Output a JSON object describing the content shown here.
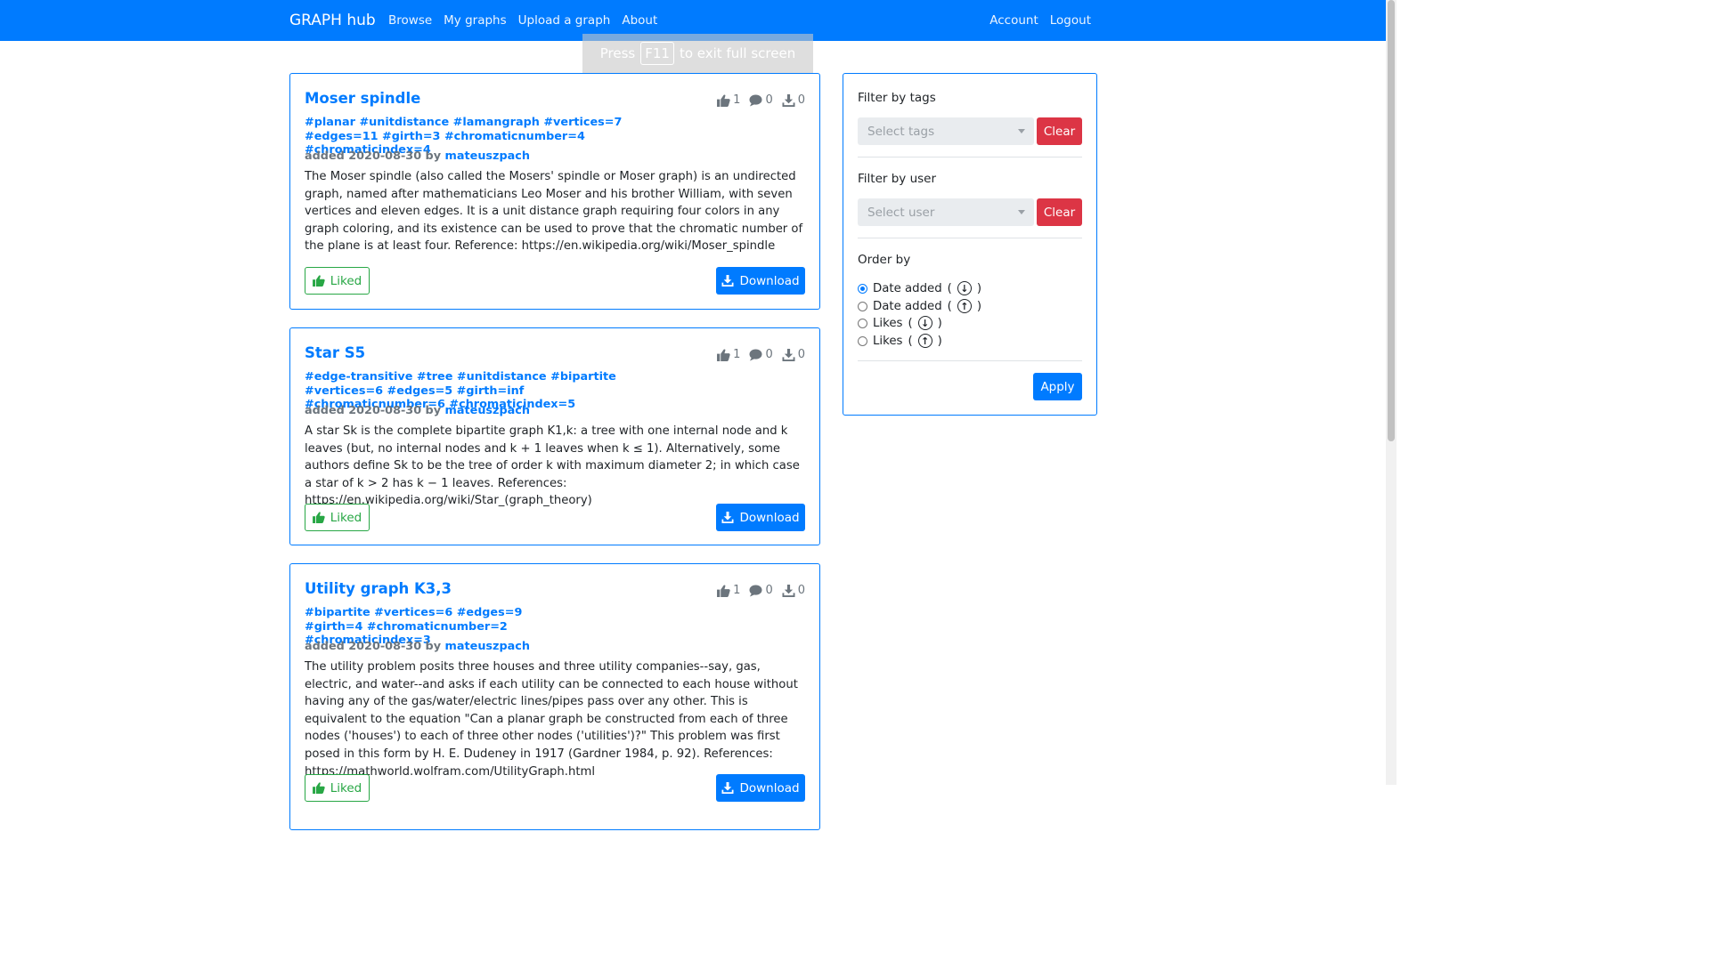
{
  "navbar": {
    "brand": "GRAPH hub",
    "links_left": [
      "Browse",
      "My graphs",
      "Upload a graph"
    ],
    "about": "About",
    "account": "Account",
    "logout": "Logout"
  },
  "fullscreen_banner": {
    "prefix": "Press",
    "key": "F11",
    "suffix": "to exit full screen"
  },
  "graphs": [
    {
      "title": "Moser spindle",
      "likes": "1",
      "comments": "0",
      "downloads": "0",
      "tags": [
        "#planar",
        "#unitdistance",
        "#lamangraph",
        "#vertices=7",
        "#edges=11",
        "#girth=3",
        "#chromaticnumber=4",
        "#chromaticindex=4"
      ],
      "added": "added 2020-08-30 by",
      "user": "mateuszpach",
      "description": "The Moser spindle (also called the Mosers' spindle or Moser graph) is an undirected graph, named after mathematicians Leo Moser and his brother William, with seven vertices and eleven edges. It is a unit distance graph requiring four colors in any graph coloring, and its existence can be used to prove that the chromatic number of the plane is at least four. Reference: https://en.wikipedia.org/wiki/Moser_spindle",
      "liked_label": "Liked",
      "download_label": "Download"
    },
    {
      "title": "Star S5",
      "likes": "1",
      "comments": "0",
      "downloads": "0",
      "tags": [
        "#edge-transitive",
        "#tree",
        "#unitdistance",
        "#bipartite",
        "#vertices=6",
        "#edges=5",
        "#girth=inf",
        "#chromaticnumber=6",
        "#chromaticindex=5"
      ],
      "added": "added 2020-08-30 by",
      "user": "mateuszpach",
      "description": "A star Sk is the complete bipartite graph K1,k: a tree with one internal node and k leaves (but, no internal nodes and k + 1 leaves when k ≤ 1). Alternatively, some authors define Sk to be the tree of order k with maximum diameter 2; in which case a star of k > 2 has k − 1 leaves. References: https://en.wikipedia.org/wiki/Star_(graph_theory)",
      "liked_label": "Liked",
      "download_label": "Download"
    },
    {
      "title": "Utility graph K3,3",
      "likes": "1",
      "comments": "0",
      "downloads": "0",
      "tags": [
        "#bipartite",
        "#vertices=6",
        "#edges=9",
        "#girth=4",
        "#chromaticnumber=2",
        "#chromaticindex=3"
      ],
      "added": "added 2020-08-30 by",
      "user": "mateuszpach",
      "description": "The utility problem posits three houses and three utility companies--say, gas, electric, and water--and asks if each utility can be connected to each house without having any of the gas/water/electric lines/pipes pass over any other. This is equivalent to the equation \"Can a planar graph be constructed from each of three nodes ('houses') to each of three other nodes ('utilities')?\" This problem was first posed in this form by H. E. Dudeney in 1917 (Gardner 1984, p. 92). References: https://mathworld.wolfram.com/UtilityGraph.html",
      "liked_label": "Liked",
      "download_label": "Download"
    }
  ],
  "sidebar": {
    "filter_tags_label": "Filter by tags",
    "tags_placeholder": "Select tags",
    "filter_user_label": "Filter by user",
    "user_placeholder": "Select user",
    "clear_label": "Clear",
    "order_label": "Order by",
    "order_options": [
      {
        "label": "Date added",
        "arrow": "down",
        "checked": true
      },
      {
        "label": "Date added",
        "arrow": "up",
        "checked": false
      },
      {
        "label": "Likes",
        "arrow": "down",
        "checked": false
      },
      {
        "label": "Likes",
        "arrow": "up",
        "checked": false
      }
    ],
    "apply_label": "Apply"
  },
  "colors": {
    "primary": "#007bff",
    "success": "#28a745",
    "danger": "#dc3545",
    "muted": "#6c757d"
  },
  "icons": {
    "likes": "thumbs-up-icon",
    "comments": "comment-icon",
    "downloads": "download-icon"
  }
}
